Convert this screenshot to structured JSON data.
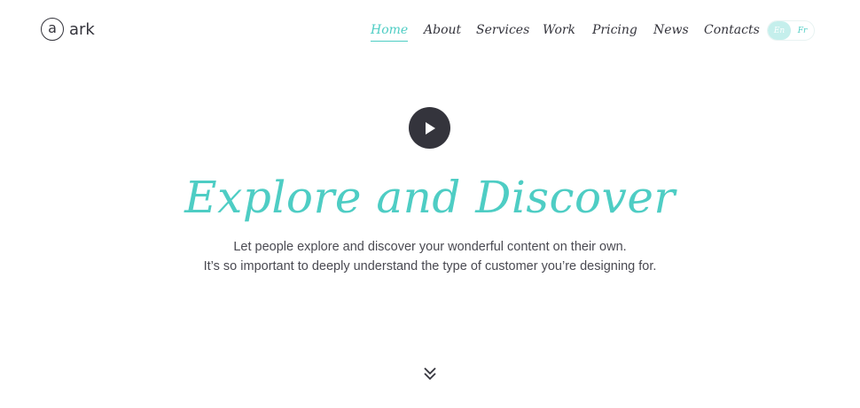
{
  "brand": {
    "mark": "a",
    "name": "ark"
  },
  "nav": {
    "items": [
      {
        "label": "Home",
        "active": true
      },
      {
        "label": "About"
      },
      {
        "label": "Services"
      },
      {
        "label": "Work"
      },
      {
        "label": "Pricing"
      },
      {
        "label": "News"
      },
      {
        "label": "Contacts"
      }
    ]
  },
  "language": {
    "options": [
      "En",
      "Fr"
    ],
    "selected": "En"
  },
  "hero": {
    "title": "Explore and Discover",
    "subtitle_line1": "Let people explore and discover your wonderful content on their own.",
    "subtitle_line2": "It’s so important to deeply understand the type of customer you’re designing for."
  },
  "icons": {
    "play": "play-icon",
    "scroll": "double-chevron-down-icon"
  },
  "colors": {
    "accent": "#4ecdc4",
    "dark": "#34343c",
    "text": "#4a4a52",
    "background": "#ffffff"
  }
}
